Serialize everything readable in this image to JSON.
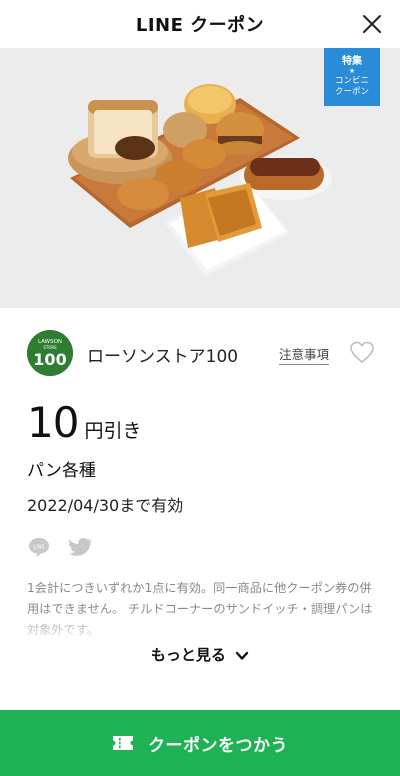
{
  "header": {
    "title": "LINE クーポン"
  },
  "hero": {
    "tag_top": "特集",
    "tag_star": "★",
    "tag_line1": "コンビニ",
    "tag_line2": "クーポン"
  },
  "store": {
    "logo_text_top": "LAWSON",
    "logo_text_mid": "STORE",
    "logo_text_num": "100",
    "name": "ローソンストア100"
  },
  "notes_label": "注意事項",
  "coupon": {
    "amount": "10",
    "unit": "円引き",
    "item": "パン各種",
    "valid_until": "2022/04/30まで有効"
  },
  "description": "1会計につきいずれか1点に有効。同一商品に他クーポン券の併用はできません。 チルドコーナーのサンドイッチ・調理パンは対象外です。",
  "more_label": "もっと見る",
  "use_button": {
    "label": "クーポンをつかう"
  },
  "colors": {
    "accent_green": "#1db354",
    "tag_blue": "#2a8cd6",
    "logo_green": "#2e7d32"
  },
  "icons": [
    "close-icon",
    "heart-icon",
    "line-share-icon",
    "twitter-share-icon",
    "chevron-down-icon",
    "ticket-icon"
  ]
}
